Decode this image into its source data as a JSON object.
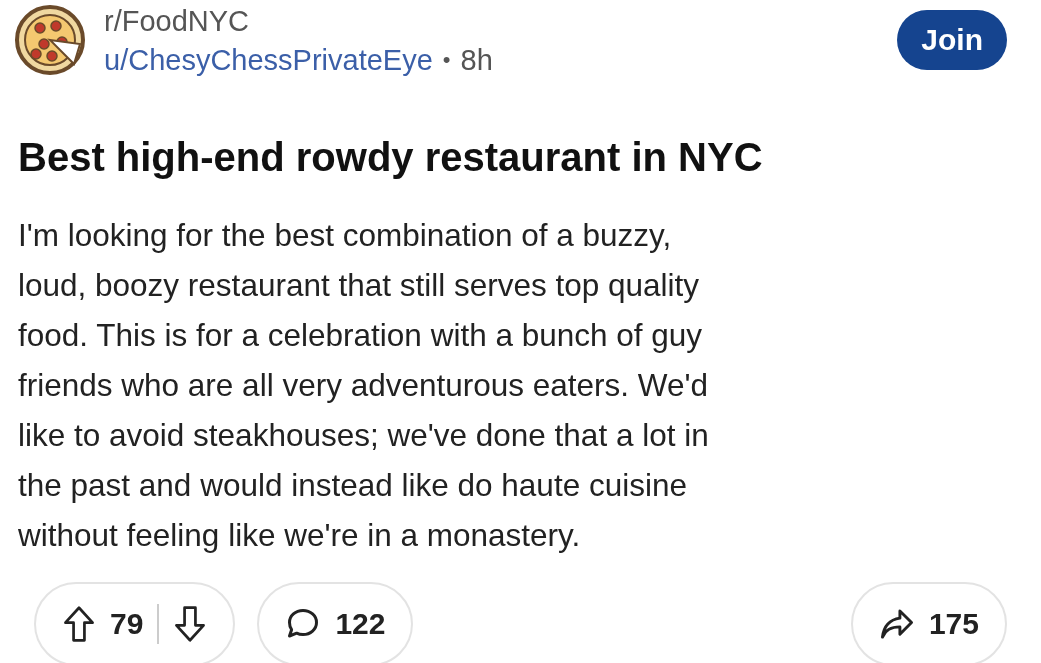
{
  "post": {
    "subreddit": "r/FoodNYC",
    "author": "u/ChesyChessPrivateEye",
    "separator": "•",
    "age": "8h",
    "join_button": "Join",
    "title": "Best high-end rowdy restaurant in NYC",
    "body_lines": [
      "I'm looking for the best combination of a buzzy,",
      "loud, boozy restaurant that still serves top quality",
      "food. This is for a celebration with a bunch of guy",
      "friends who are all very adventurous eaters. We'd",
      "like to avoid steakhouses; we've done that a lot in",
      "the past and would instead like do haute cuisine",
      "without feeling like we're in a monastery."
    ]
  },
  "actions": {
    "votes": "79",
    "comments": "122",
    "shares": "175"
  }
}
